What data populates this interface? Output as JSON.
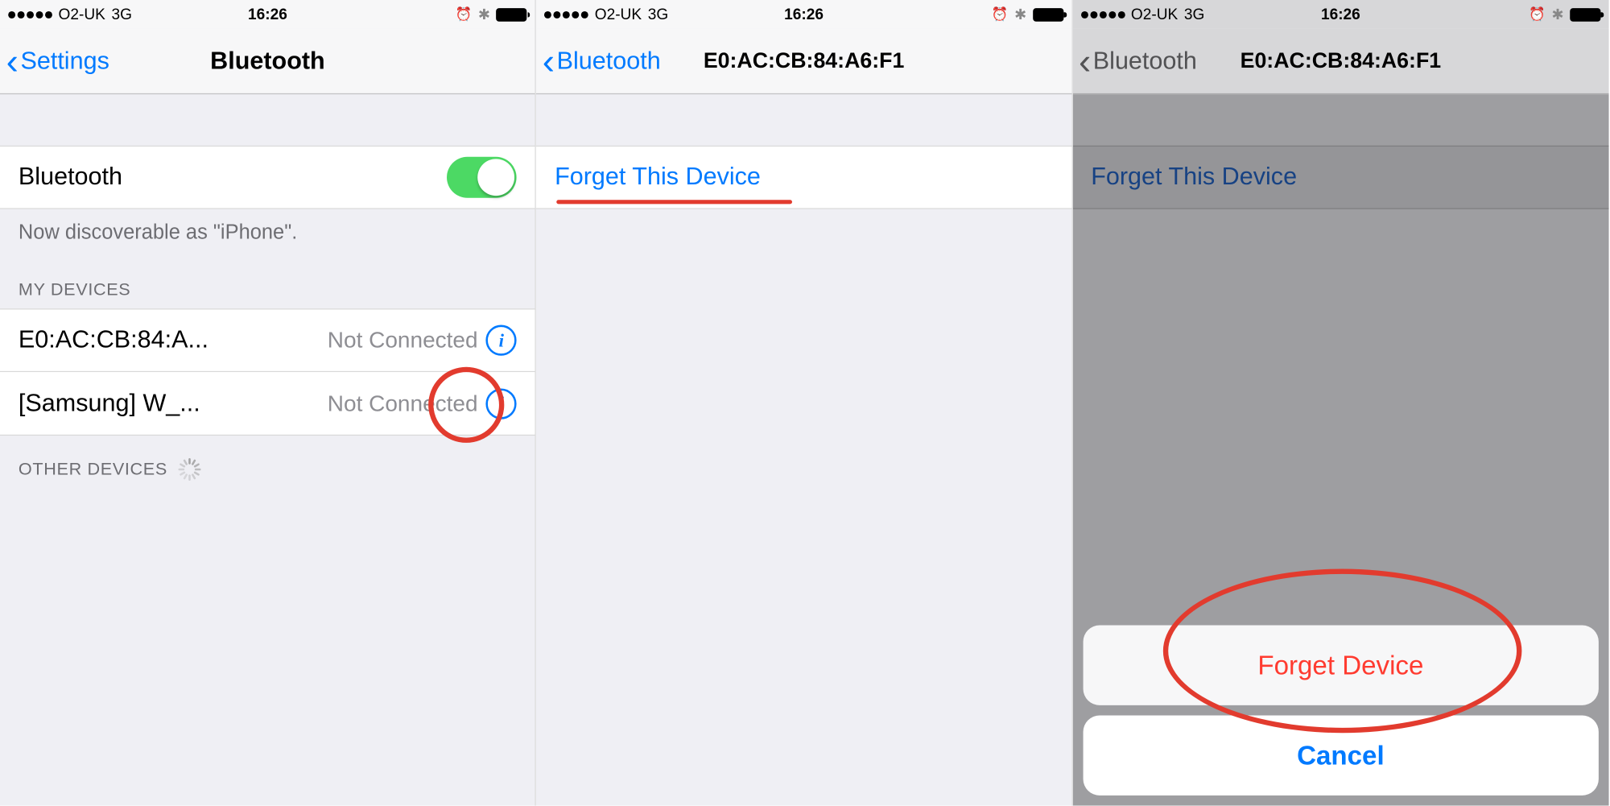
{
  "status_bar": {
    "carrier": "O2-UK",
    "network": "3G",
    "time": "16:26",
    "alarm_glyph": "⏰",
    "bluetooth_glyph": "✱"
  },
  "screen1": {
    "back_label": "Settings",
    "title": "Bluetooth",
    "bluetooth_row_label": "Bluetooth",
    "discoverable_text": "Now discoverable as \"iPhone\".",
    "my_devices_header": "MY DEVICES",
    "devices": [
      {
        "name": "E0:AC:CB:84:A...",
        "status": "Not Connected"
      },
      {
        "name": "[Samsung] W_...",
        "status": "Not Connected"
      }
    ],
    "other_devices_header": "OTHER DEVICES"
  },
  "screen2": {
    "back_label": "Bluetooth",
    "title": "E0:AC:CB:84:A6:F1",
    "forget_label": "Forget This Device"
  },
  "screen3": {
    "back_label": "Bluetooth",
    "title": "E0:AC:CB:84:A6:F1",
    "forget_label": "Forget This Device",
    "sheet_destructive": "Forget Device",
    "sheet_cancel": "Cancel"
  }
}
